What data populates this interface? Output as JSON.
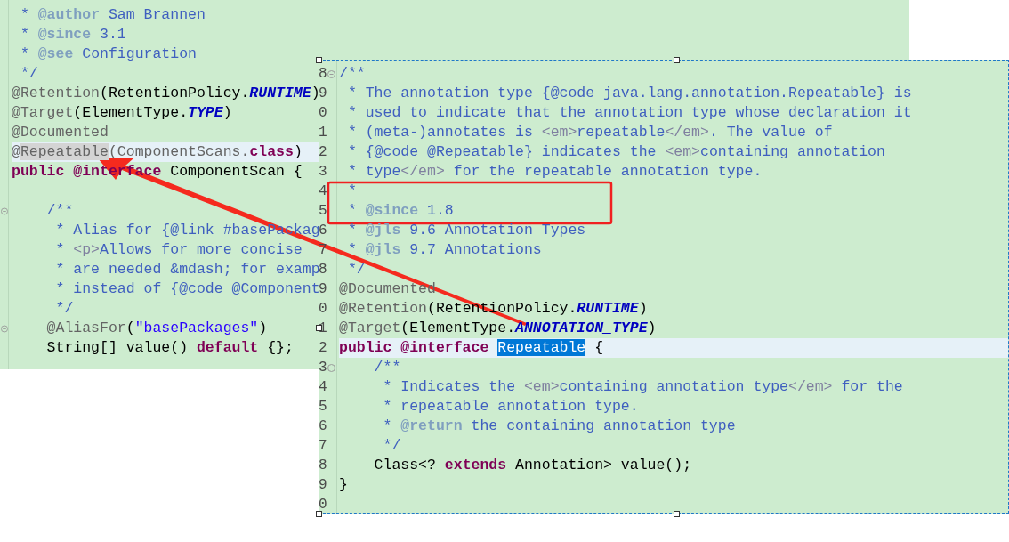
{
  "left_editor": {
    "lines": [
      {
        "fold": false,
        "current": false,
        "segments": [
          {
            "kind": "comment",
            "text": " * "
          },
          {
            "kind": "doctag",
            "text": "@author"
          },
          {
            "kind": "comment",
            "text": " Sam Brannen"
          }
        ]
      },
      {
        "fold": false,
        "current": false,
        "segments": [
          {
            "kind": "comment",
            "text": " * "
          },
          {
            "kind": "doctag",
            "text": "@since"
          },
          {
            "kind": "comment",
            "text": " 3.1"
          }
        ]
      },
      {
        "fold": false,
        "current": false,
        "segments": [
          {
            "kind": "comment",
            "text": " * "
          },
          {
            "kind": "doctag",
            "text": "@see"
          },
          {
            "kind": "comment",
            "text": " Configuration"
          }
        ]
      },
      {
        "fold": false,
        "current": false,
        "segments": [
          {
            "kind": "comment",
            "text": " */"
          }
        ]
      },
      {
        "fold": false,
        "current": false,
        "segments": [
          {
            "kind": "annotation",
            "text": "@Retention"
          },
          {
            "kind": "plain",
            "text": "(RetentionPolicy."
          },
          {
            "kind": "constant",
            "text": "RUNTIME"
          },
          {
            "kind": "plain",
            "text": ")"
          }
        ]
      },
      {
        "fold": false,
        "current": false,
        "segments": [
          {
            "kind": "annotation",
            "text": "@Target"
          },
          {
            "kind": "plain",
            "text": "(ElementType."
          },
          {
            "kind": "constant",
            "text": "TYPE"
          },
          {
            "kind": "plain",
            "text": ")"
          }
        ]
      },
      {
        "fold": false,
        "current": false,
        "segments": [
          {
            "kind": "annotation",
            "text": "@Documented"
          }
        ]
      },
      {
        "fold": false,
        "current": true,
        "segments": [
          {
            "kind": "annotation",
            "text": "@"
          },
          {
            "kind": "occurrence",
            "text": "Repeatable"
          },
          {
            "kind": "annotation",
            "text": "(ComponentScans."
          },
          {
            "kind": "keyword",
            "text": "class"
          },
          {
            "kind": "plain",
            "text": ")"
          }
        ]
      },
      {
        "fold": false,
        "current": false,
        "segments": [
          {
            "kind": "keyword",
            "text": "public @interface"
          },
          {
            "kind": "plain",
            "text": " ComponentScan {"
          }
        ]
      },
      {
        "fold": false,
        "current": false
      },
      {
        "fold": true,
        "current": false,
        "segments": [
          {
            "kind": "comment",
            "text": "    /**"
          }
        ]
      },
      {
        "fold": false,
        "current": false,
        "segments": [
          {
            "kind": "comment",
            "text": "     * Alias for {@link #basePackag"
          }
        ]
      },
      {
        "fold": false,
        "current": false,
        "segments": [
          {
            "kind": "comment",
            "text": "     * "
          },
          {
            "kind": "html",
            "text": "<p>"
          },
          {
            "kind": "comment",
            "text": "Allows for more concise"
          }
        ]
      },
      {
        "fold": false,
        "current": false,
        "segments": [
          {
            "kind": "comment",
            "text": "     * are needed &mdash; for examp"
          }
        ]
      },
      {
        "fold": false,
        "current": false,
        "segments": [
          {
            "kind": "comment",
            "text": "     * instead of {@code @Component"
          }
        ]
      },
      {
        "fold": false,
        "current": false,
        "segments": [
          {
            "kind": "comment",
            "text": "     */"
          }
        ]
      },
      {
        "fold": true,
        "current": false,
        "segments": [
          {
            "kind": "annotation",
            "text": "    @AliasFor"
          },
          {
            "kind": "plain",
            "text": "("
          },
          {
            "kind": "string",
            "text": "\"basePackages\""
          },
          {
            "kind": "plain",
            "text": ")"
          }
        ]
      },
      {
        "fold": false,
        "current": false,
        "segments": [
          {
            "kind": "plain",
            "text": "    String[] value() "
          },
          {
            "kind": "keyword",
            "text": "default"
          },
          {
            "kind": "plain",
            "text": " {};"
          }
        ]
      }
    ]
  },
  "popup_editor": {
    "lines": [
      {
        "number": "8",
        "fold": true,
        "current": false,
        "segments": [
          {
            "kind": "comment",
            "text": "/**"
          }
        ]
      },
      {
        "number": "9",
        "fold": false,
        "current": false,
        "segments": [
          {
            "kind": "comment",
            "text": " * The annotation type {@code java.lang.annotation.Repeatable} is"
          }
        ]
      },
      {
        "number": "0",
        "fold": false,
        "current": false,
        "segments": [
          {
            "kind": "comment",
            "text": " * used to indicate that the annotation type whose declaration it"
          }
        ]
      },
      {
        "number": "1",
        "fold": false,
        "current": false,
        "segments": [
          {
            "kind": "comment",
            "text": " * (meta-)annotates is "
          },
          {
            "kind": "html",
            "text": "<em>"
          },
          {
            "kind": "comment",
            "text": "repeatable"
          },
          {
            "kind": "html",
            "text": "</em>"
          },
          {
            "kind": "comment",
            "text": ". The value of"
          }
        ]
      },
      {
        "number": "2",
        "fold": false,
        "current": false,
        "segments": [
          {
            "kind": "comment",
            "text": " * {@code @Repeatable} indicates the "
          },
          {
            "kind": "html",
            "text": "<em>"
          },
          {
            "kind": "comment",
            "text": "containing annotation"
          }
        ]
      },
      {
        "number": "3",
        "fold": false,
        "current": false,
        "segments": [
          {
            "kind": "comment",
            "text": " * type"
          },
          {
            "kind": "html",
            "text": "</em>"
          },
          {
            "kind": "comment",
            "text": " for the repeatable annotation type."
          }
        ]
      },
      {
        "number": "4",
        "fold": false,
        "current": false,
        "segments": [
          {
            "kind": "comment",
            "text": " *"
          }
        ]
      },
      {
        "number": "5",
        "fold": false,
        "current": false,
        "segments": [
          {
            "kind": "comment",
            "text": " * "
          },
          {
            "kind": "doctag",
            "text": "@since"
          },
          {
            "kind": "comment",
            "text": " 1.8"
          }
        ]
      },
      {
        "number": "6",
        "fold": false,
        "current": false,
        "segments": [
          {
            "kind": "comment",
            "text": " * "
          },
          {
            "kind": "doctag",
            "text": "@jls"
          },
          {
            "kind": "comment",
            "text": " 9.6 Annotation Types"
          }
        ]
      },
      {
        "number": "7",
        "fold": false,
        "current": false,
        "segments": [
          {
            "kind": "comment",
            "text": " * "
          },
          {
            "kind": "doctag",
            "text": "@jls"
          },
          {
            "kind": "comment",
            "text": " 9.7 Annotations"
          }
        ]
      },
      {
        "number": "8",
        "fold": false,
        "current": false,
        "segments": [
          {
            "kind": "comment",
            "text": " */"
          }
        ]
      },
      {
        "number": "9",
        "fold": false,
        "current": false,
        "segments": [
          {
            "kind": "annotation",
            "text": "@Documented"
          }
        ]
      },
      {
        "number": "0",
        "fold": false,
        "current": false,
        "segments": [
          {
            "kind": "annotation",
            "text": "@Retention"
          },
          {
            "kind": "plain",
            "text": "(RetentionPolicy."
          },
          {
            "kind": "constant",
            "text": "RUNTIME"
          },
          {
            "kind": "plain",
            "text": ")"
          }
        ]
      },
      {
        "number": "1",
        "fold": false,
        "current": false,
        "segments": [
          {
            "kind": "annotation",
            "text": "@Target"
          },
          {
            "kind": "plain",
            "text": "(ElementType."
          },
          {
            "kind": "constant",
            "text": "ANNOTATION_TYPE"
          },
          {
            "kind": "plain",
            "text": ")"
          }
        ]
      },
      {
        "number": "2",
        "fold": false,
        "current": true,
        "segments": [
          {
            "kind": "keyword",
            "text": "public @interface "
          },
          {
            "kind": "selection",
            "text": "Repeatable"
          },
          {
            "kind": "plain",
            "text": " {"
          }
        ]
      },
      {
        "number": "3",
        "fold": true,
        "current": false,
        "segments": [
          {
            "kind": "comment",
            "text": "    /**"
          }
        ]
      },
      {
        "number": "4",
        "fold": false,
        "current": false,
        "segments": [
          {
            "kind": "comment",
            "text": "     * Indicates the "
          },
          {
            "kind": "html",
            "text": "<em>"
          },
          {
            "kind": "comment",
            "text": "containing annotation type"
          },
          {
            "kind": "html",
            "text": "</em>"
          },
          {
            "kind": "comment",
            "text": " for the"
          }
        ]
      },
      {
        "number": "5",
        "fold": false,
        "current": false,
        "segments": [
          {
            "kind": "comment",
            "text": "     * repeatable annotation type."
          }
        ]
      },
      {
        "number": "6",
        "fold": false,
        "current": false,
        "segments": [
          {
            "kind": "comment",
            "text": "     * "
          },
          {
            "kind": "doctag",
            "text": "@return"
          },
          {
            "kind": "comment",
            "text": " the containing annotation type"
          }
        ]
      },
      {
        "number": "7",
        "fold": false,
        "current": false,
        "segments": [
          {
            "kind": "comment",
            "text": "     */"
          }
        ]
      },
      {
        "number": "8",
        "fold": false,
        "current": false,
        "segments": [
          {
            "kind": "plain",
            "text": "    Class<? "
          },
          {
            "kind": "keyword",
            "text": "extends"
          },
          {
            "kind": "plain",
            "text": " Annotation> value();"
          }
        ]
      },
      {
        "number": "9",
        "fold": false,
        "current": false,
        "segments": [
          {
            "kind": "plain",
            "text": "}"
          }
        ]
      },
      {
        "number": "0",
        "fold": false,
        "current": false
      }
    ]
  }
}
